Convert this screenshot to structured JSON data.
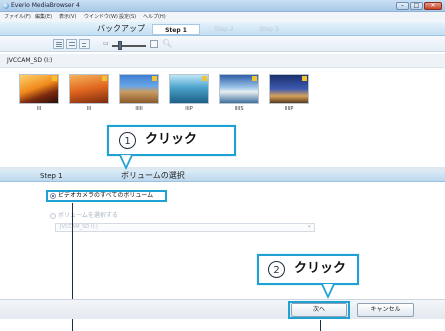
{
  "window": {
    "title": "Everio MediaBrowser 4",
    "controls": [
      "–",
      "□",
      "✕"
    ]
  },
  "menu": {
    "items": [
      "ファイル(F)",
      "編集(E)",
      "表示(V)",
      "ウインドウ(W)",
      "設定(S)",
      "ヘルプ(H)"
    ]
  },
  "header": {
    "title": "バックアップ",
    "steps": [
      "Step 1",
      "Step 2",
      "Step 3"
    ]
  },
  "toolbar": {
    "zoom_small_icon": "small-thumbnail-icon",
    "zoom_large_icon": "large-thumbnail-icon",
    "magnifier_icon": "magnifier-icon"
  },
  "volume": {
    "name": "JVCCAM_SD (I:)"
  },
  "thumbnails": [
    {
      "label": "III"
    },
    {
      "label": "III"
    },
    {
      "label": "IIIII"
    },
    {
      "label": "IIIP"
    },
    {
      "label": "IIIIS"
    },
    {
      "label": "IIIIP"
    }
  ],
  "panel": {
    "step_label": "Step 1",
    "title": "ボリュームの選択",
    "option_all": "ビデオカメラのすべてのボリューム",
    "option_select": "ボリュームを選択する",
    "select_value": "JVCCAM_SD (I:)"
  },
  "callouts": [
    {
      "number": "1",
      "text": "クリック"
    },
    {
      "number": "2",
      "text": "クリック"
    }
  ],
  "buttons": {
    "next": "次へ",
    "cancel": "キャンセル"
  },
  "colors": {
    "accent": "#1fa2d3",
    "header_blue": "#c2dff2"
  }
}
